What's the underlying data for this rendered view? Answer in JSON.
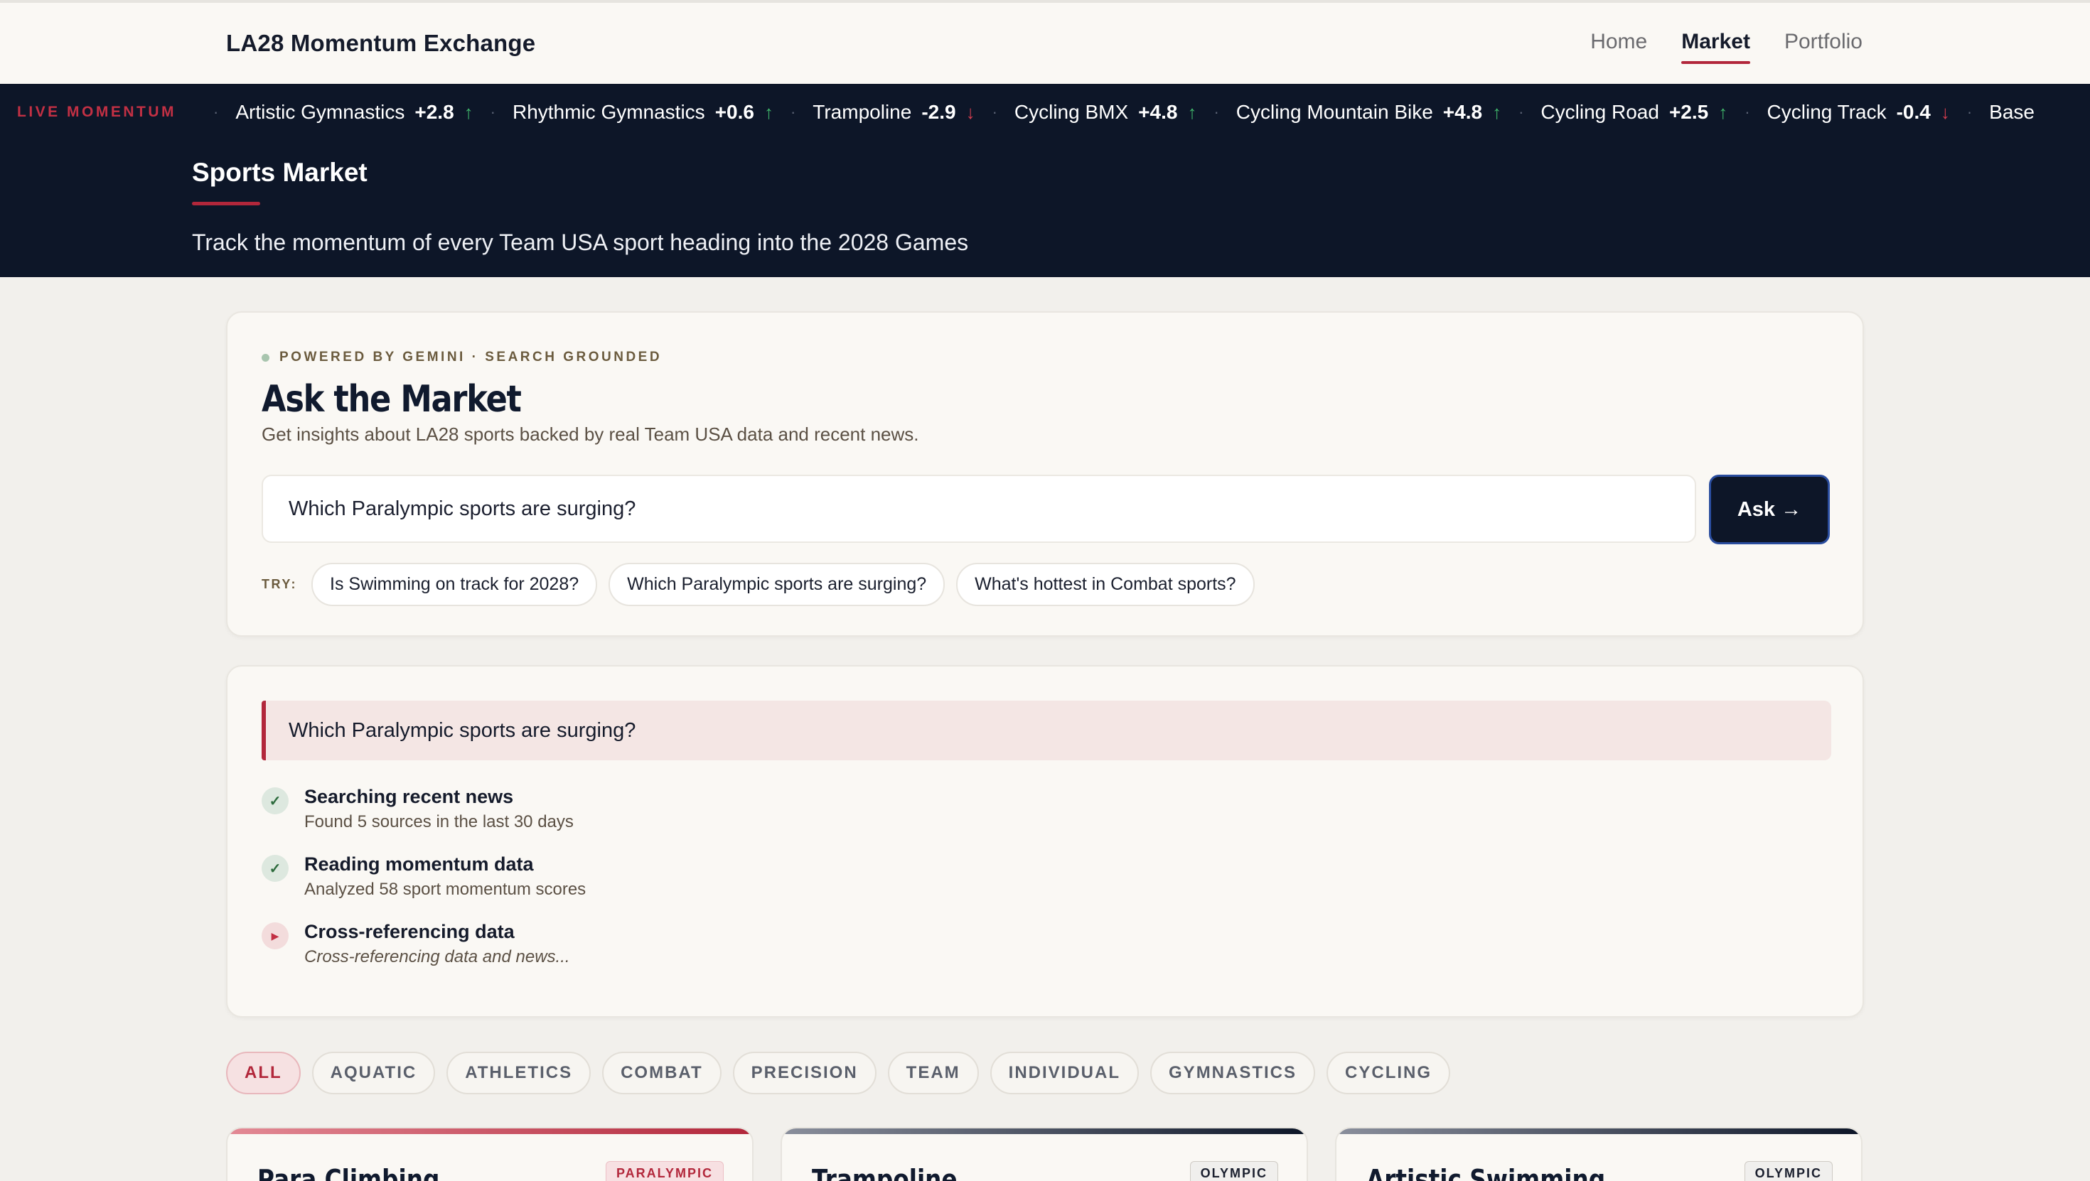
{
  "header": {
    "brand": "LA28 Momentum Exchange",
    "nav": [
      "Home",
      "Market",
      "Portfolio"
    ],
    "active_nav": "Market"
  },
  "ticker": {
    "label": "LIVE MOMENTUM",
    "items": [
      {
        "name": "Artistic Gymnastics",
        "value": "+2.8",
        "dir": "up"
      },
      {
        "name": "Rhythmic Gymnastics",
        "value": "+0.6",
        "dir": "up"
      },
      {
        "name": "Trampoline",
        "value": "-2.9",
        "dir": "down"
      },
      {
        "name": "Cycling BMX",
        "value": "+4.8",
        "dir": "up"
      },
      {
        "name": "Cycling Mountain Bike",
        "value": "+4.8",
        "dir": "up"
      },
      {
        "name": "Cycling Road",
        "value": "+2.5",
        "dir": "up"
      },
      {
        "name": "Cycling Track",
        "value": "-0.4",
        "dir": "down"
      },
      {
        "name": "Base",
        "value": "",
        "dir": ""
      }
    ],
    "colors": {
      "up": "#3fb56a",
      "down": "#d23c4e"
    }
  },
  "hero": {
    "title": "Sports Market",
    "subtitle": "Track the momentum of every Team USA sport heading into the 2028 Games"
  },
  "ask": {
    "powered": "POWERED BY GEMINI · SEARCH GROUNDED",
    "title": "Ask the Market",
    "description": "Get insights about LA28 sports backed by real Team USA data and recent news.",
    "input_value": "Which Paralympic sports are surging?",
    "button": "Ask →",
    "try_label": "TRY:",
    "suggestions": [
      "Is Swimming on track for 2028?",
      "Which Paralympic sports are surging?",
      "What's hottest in Combat sports?"
    ]
  },
  "answer": {
    "query": "Which Paralympic sports are surging?",
    "steps": [
      {
        "title": "Searching recent news",
        "sub": "Found 5 sources in the last 30 days",
        "status": "done"
      },
      {
        "title": "Reading momentum data",
        "sub": "Analyzed 58 sport momentum scores",
        "status": "done"
      },
      {
        "title": "Cross-referencing data",
        "sub": "Cross-referencing data and news...",
        "status": "active"
      }
    ]
  },
  "filters": {
    "items": [
      "ALL",
      "AQUATIC",
      "ATHLETICS",
      "COMBAT",
      "PRECISION",
      "TEAM",
      "INDIVIDUAL",
      "GYMNASTICS",
      "CYCLING"
    ],
    "active": "ALL"
  },
  "sport_cards": [
    {
      "name": "Para Climbing",
      "badge": "PARALYMPIC",
      "type": "para"
    },
    {
      "name": "Trampoline",
      "badge": "OLYMPIC",
      "type": "oly"
    },
    {
      "name": "Artistic Swimming",
      "badge": "OLYMPIC",
      "type": "oly"
    }
  ],
  "colors": {
    "accent": "#b2273b",
    "navy": "#0d1628",
    "up": "#3fb56a",
    "down": "#d23c4e"
  }
}
